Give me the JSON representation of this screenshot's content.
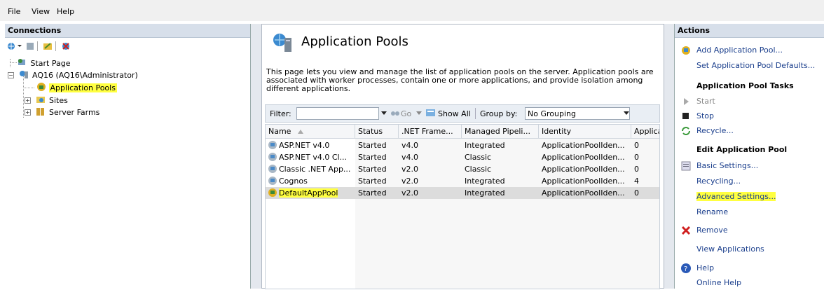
{
  "menu": {
    "file": "File",
    "view": "View",
    "help": "Help"
  },
  "connections": {
    "title": "Connections",
    "tree": [
      {
        "label": "Start Page"
      },
      {
        "label": "AQ16 (AQ16\\Administrator)"
      },
      {
        "label": "Application Pools"
      },
      {
        "label": "Sites"
      },
      {
        "label": "Server Farms"
      }
    ]
  },
  "main": {
    "title": "Application Pools",
    "description": "This page lets you view and manage the list of application pools on the server. Application pools are associated with worker processes, contain one or more applications, and provide isolation among different applications.",
    "filter_label": "Filter:",
    "filter_value": "",
    "go_label": "Go",
    "show_all_label": "Show All",
    "group_by_label": "Group by:",
    "group_by_value": "No Grouping",
    "columns": [
      "Name",
      "Status",
      ".NET Frame...",
      "Managed Pipeli...",
      "Identity",
      "Applica"
    ],
    "rows": [
      {
        "name": "ASP.NET v4.0",
        "status": "Started",
        "net": "v4.0",
        "pipeline": "Integrated",
        "identity": "ApplicationPoolIden...",
        "apps": "0"
      },
      {
        "name": "ASP.NET v4.0 Cl...",
        "status": "Started",
        "net": "v4.0",
        "pipeline": "Classic",
        "identity": "ApplicationPoolIden...",
        "apps": "0"
      },
      {
        "name": "Classic .NET App...",
        "status": "Started",
        "net": "v2.0",
        "pipeline": "Classic",
        "identity": "ApplicationPoolIden...",
        "apps": "0"
      },
      {
        "name": "Cognos",
        "status": "Started",
        "net": "v2.0",
        "pipeline": "Integrated",
        "identity": "ApplicationPoolIden...",
        "apps": "4"
      },
      {
        "name": "DefaultAppPool",
        "status": "Started",
        "net": "v2.0",
        "pipeline": "Integrated",
        "identity": "ApplicationPoolIden...",
        "apps": "0"
      }
    ]
  },
  "actions": {
    "title": "Actions",
    "add_pool": "Add Application Pool...",
    "set_defaults": "Set Application Pool Defaults...",
    "tasks_header": "Application Pool Tasks",
    "start": "Start",
    "stop": "Stop",
    "recycle": "Recycle...",
    "edit_header": "Edit Application Pool",
    "basic_settings": "Basic Settings...",
    "recycling": "Recycling...",
    "advanced_settings": "Advanced Settings...",
    "rename": "Rename",
    "remove": "Remove",
    "view_applications": "View Applications",
    "help": "Help",
    "online_help": "Online Help"
  },
  "colors": {
    "highlight": "#ffff40",
    "link": "#1a3e8c",
    "header_bg": "#d7dfea"
  }
}
